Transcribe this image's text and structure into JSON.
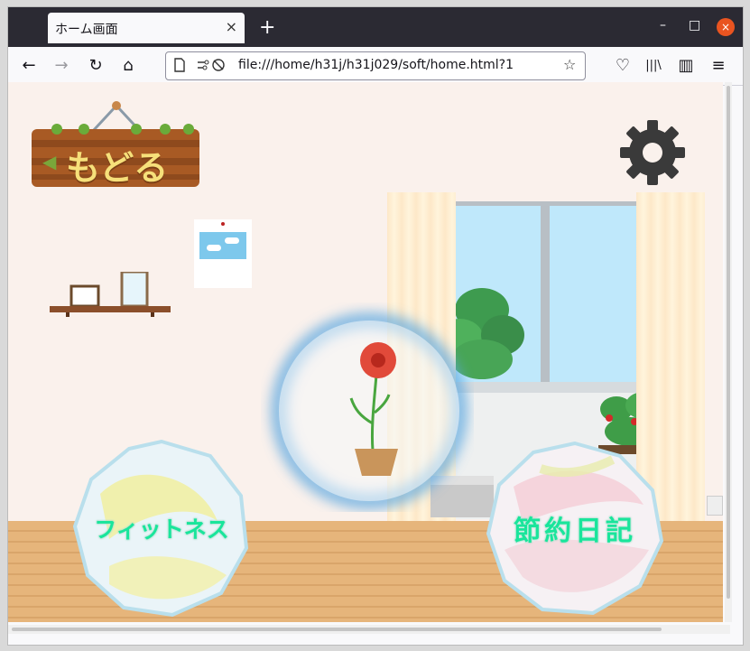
{
  "browser": {
    "tab_title": "ホーム画面",
    "tab_close": "×",
    "new_tab": "+",
    "url": "file:///home/h31j/h31j029/soft/home.html?1",
    "minimize": "–",
    "maximize": "□",
    "close": "×",
    "nav": {
      "back": "←",
      "forward": "→",
      "reload": "↻",
      "home": "⌂"
    },
    "toolbar": {
      "pocket": "♡",
      "library": "|||\\",
      "sidebar": "▥",
      "menu": "≡",
      "bookmark": "☆"
    }
  },
  "page": {
    "back_sign_label": "もどる",
    "back_sign_arrow": "◀",
    "fitness_label": "フィットネス",
    "diary_label": "節約日記"
  },
  "colors": {
    "label_green": "#19e59b",
    "wall": "#faf1ec",
    "floor": "#e6b57b",
    "gear": "#3a3a3a",
    "glow": "#5ca7e0"
  }
}
